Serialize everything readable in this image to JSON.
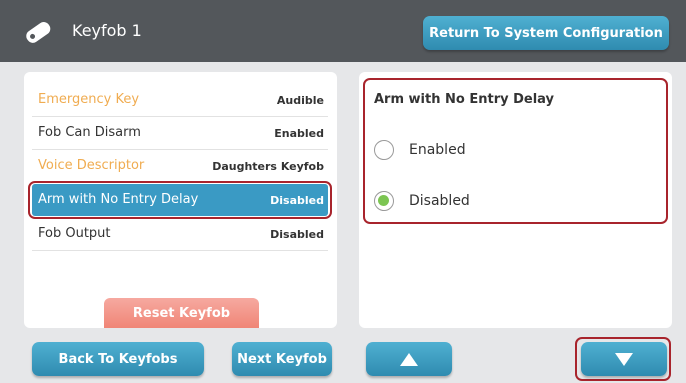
{
  "header": {
    "title": "Keyfob 1",
    "return_label": "Return To System Configuration",
    "icon": "keyfob-icon"
  },
  "settings": [
    {
      "label": "Emergency Key",
      "value": "Audible"
    },
    {
      "label": "Fob Can Disarm",
      "value": "Enabled"
    },
    {
      "label": "Voice Descriptor",
      "value": "Daughters Keyfob"
    },
    {
      "label": "Arm with No Entry Delay",
      "value": "Disabled"
    },
    {
      "label": "Fob Output",
      "value": "Disabled"
    }
  ],
  "reset_label": "Reset Keyfob",
  "detail": {
    "title": "Arm with No Entry Delay",
    "options": [
      {
        "label": "Enabled",
        "checked": false
      },
      {
        "label": "Disabled",
        "checked": true
      }
    ]
  },
  "footer": {
    "back_label": "Back To Keyfobs",
    "next_label": "Next Keyfob",
    "up_icon": "arrow-up-icon",
    "down_icon": "arrow-down-icon"
  },
  "colors": {
    "header_bg": "#53575b",
    "accent_blue": "#3a9ac4",
    "orange_label": "#f0ac51",
    "highlight_red": "#a8242c",
    "radio_green": "#7cc552"
  }
}
